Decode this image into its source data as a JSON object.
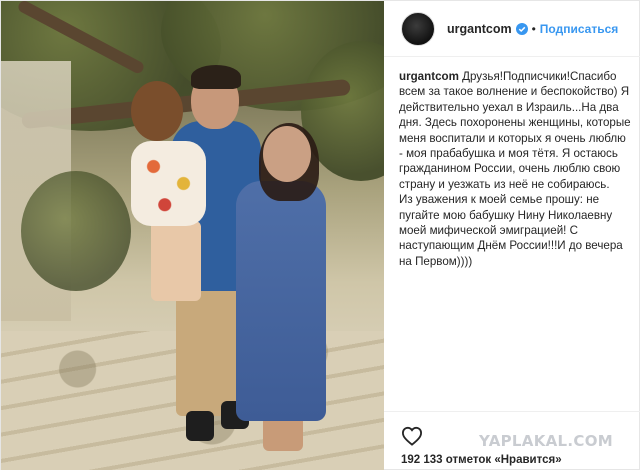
{
  "post": {
    "username": "urgantcom",
    "follow_label": "Подписаться",
    "separator": "•",
    "caption_user": "urgantcom",
    "caption_text": " Друзья!Подписчики!Спасибо всем за такое волнение и беспокойство) Я действительно уехал в Израиль...На два дня. Здесь похоронены женщины, которые меня воспитали и которых я очень люблю - моя прабабушка и моя тётя. Я остаюсь гражданином России, очень люблю свою страну и уезжать из неё не собираюсь.\nИз уважения к моей семье прошу: не пугайте мою бабушку Нину Николаевну моей мифической эмиграцией! С наступающим Днём России!!!И до вечера на Первом))))",
    "likes_text": "192 133 отметок «Нравится»"
  },
  "watermark": "YAPLAKAL.COM",
  "colors": {
    "accent": "#3897f0",
    "text": "#262626",
    "border": "#efefef"
  },
  "icons": {
    "verified": "verified-badge-icon",
    "like": "heart-outline-icon"
  }
}
